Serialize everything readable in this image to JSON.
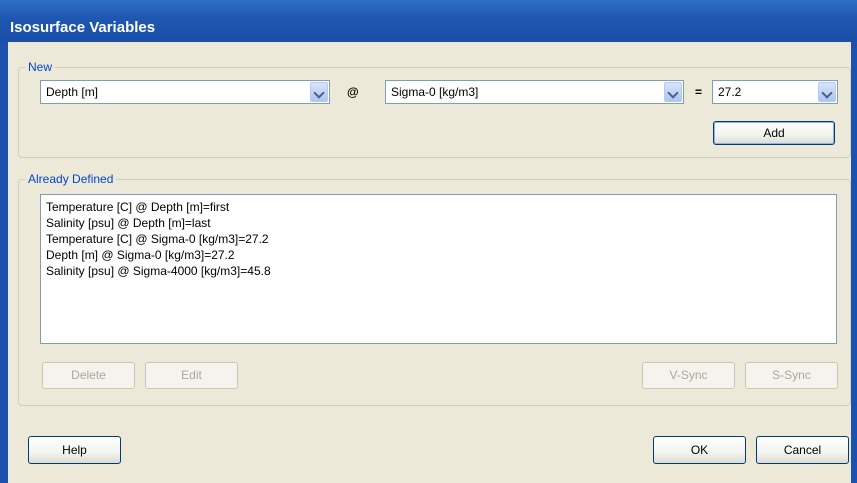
{
  "window": {
    "title": "Isosurface Variables"
  },
  "new_group": {
    "legend": "New",
    "variable_value": "Depth [m]",
    "at_symbol": "@",
    "surface_value": "Sigma-0 [kg/m3]",
    "equals_symbol": "=",
    "level_value": "27.2",
    "add_label": "Add"
  },
  "defined_group": {
    "legend": "Already Defined",
    "items": [
      "Temperature [C] @ Depth [m]=first",
      "Salinity [psu] @ Depth [m]=last",
      "Temperature [C] @ Sigma-0 [kg/m3]=27.2",
      "Depth [m] @ Sigma-0 [kg/m3]=27.2",
      "Salinity [psu] @ Sigma-4000 [kg/m3]=45.8"
    ],
    "delete_label": "Delete",
    "edit_label": "Edit",
    "vsync_label": "V-Sync",
    "ssync_label": "S-Sync"
  },
  "footer": {
    "help_label": "Help",
    "ok_label": "OK",
    "cancel_label": "Cancel"
  },
  "colors": {
    "title_bar": "#1e56b0",
    "legend_text": "#0046d5",
    "dialog_bg": "#ece9d8"
  }
}
